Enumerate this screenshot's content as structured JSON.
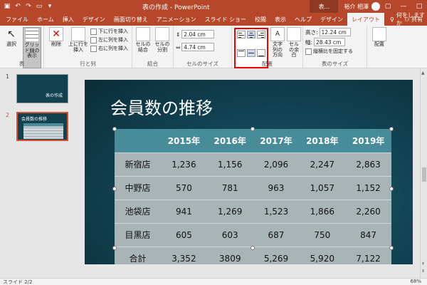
{
  "titlebar": {
    "doc_title": "表の作成 - PowerPoint",
    "context_tab": "表...",
    "user_name": "裕介 相澤",
    "icons": [
      "save-icon",
      "undo-icon",
      "redo-icon",
      "start-from-beginning-icon"
    ]
  },
  "tabs": [
    "ファイル",
    "ホーム",
    "挿入",
    "デザイン",
    "画面切り替え",
    "アニメーション",
    "スライド ショー",
    "校閲",
    "表示",
    "ヘルプ",
    "デザイン",
    "レイアウト"
  ],
  "active_tab_index": 11,
  "tell_me": "何をしますか",
  "share": "共有",
  "ribbon": {
    "table_group": {
      "label": "表",
      "select": "選択",
      "gridlines": "グリッド線の表示"
    },
    "rows_columns": {
      "label": "行と列",
      "delete": "削除",
      "insert_above": "上に行を挿入",
      "insert_below": "下に行を挿入",
      "insert_left": "左に列を挿入",
      "insert_right": "右に列を挿入"
    },
    "merge": {
      "label": "結合",
      "merge_cells": "セルの結合",
      "split_cells": "セルの分割"
    },
    "cell_size": {
      "label": "セルのサイズ",
      "height": "2.04 cm",
      "width": "4.74 cm"
    },
    "alignment": {
      "label": "配置",
      "text_direction": "文字列の方向",
      "cell_margins": "セルの余白"
    },
    "table_size": {
      "label": "表のサイズ",
      "height_label": "高さ:",
      "height": "12.24 cm",
      "width_label": "幅:",
      "width": "28.43 cm",
      "lock_aspect": "縦横比を固定する"
    },
    "arrange": {
      "label": "配置"
    }
  },
  "thumbnails": [
    {
      "num": "1",
      "title": "表の作成"
    },
    {
      "num": "2",
      "title": "会員数の推移"
    }
  ],
  "slide": {
    "title": "会員数の推移",
    "table": {
      "headers": [
        "",
        "2015年",
        "2016年",
        "2017年",
        "2018年",
        "2019年"
      ],
      "rows": [
        [
          "新宿店",
          "1,236",
          "1,156",
          "2,096",
          "2,247",
          "2,863"
        ],
        [
          "中野店",
          "570",
          "781",
          "963",
          "1,057",
          "1,152"
        ],
        [
          "池袋店",
          "941",
          "1,269",
          "1,523",
          "1,866",
          "2,260"
        ],
        [
          "目黒店",
          "605",
          "603",
          "687",
          "750",
          "847"
        ],
        [
          "合計",
          "3,352",
          "3809",
          "5,269",
          "5,920",
          "7,122"
        ]
      ]
    }
  },
  "statusbar": {
    "slide_info": "スライド 2/2",
    "zoom": "68%"
  }
}
